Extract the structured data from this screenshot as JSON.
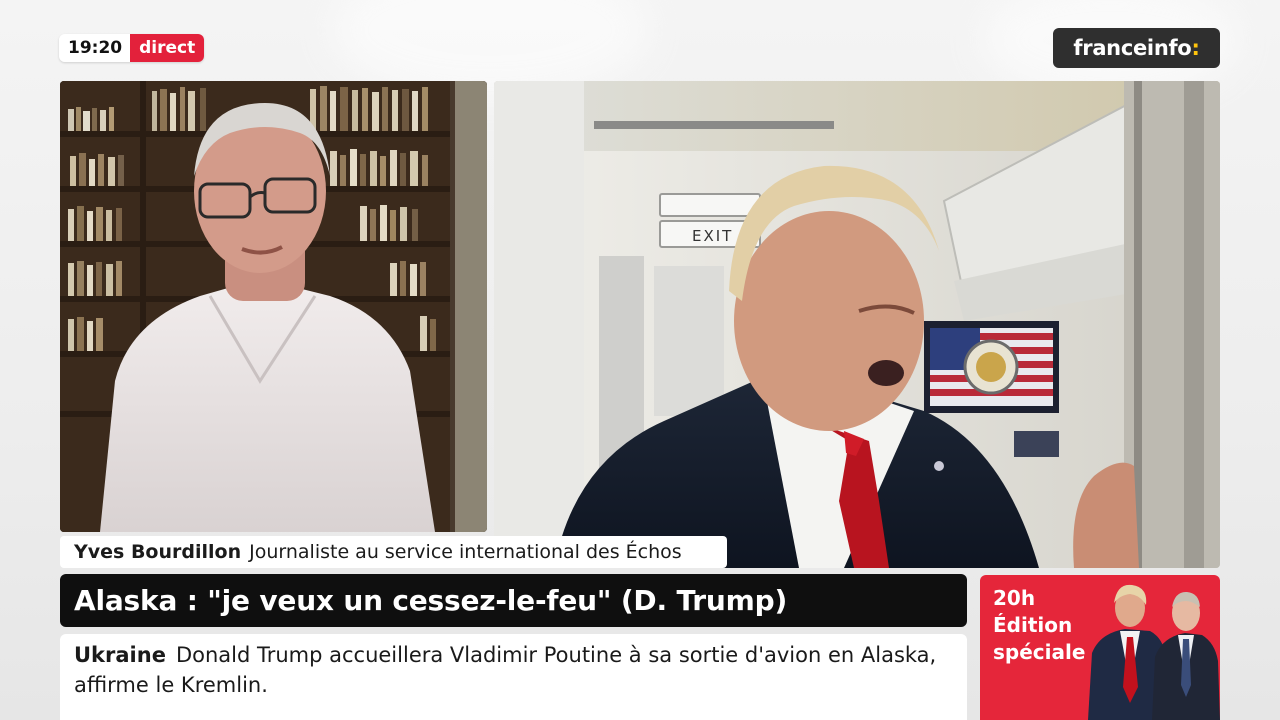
{
  "live_badge": {
    "time": "19:20",
    "label": "direct"
  },
  "brand": {
    "name": "franceinfo",
    "colon": ":"
  },
  "panels": {
    "left": {
      "signage": []
    },
    "right": {
      "exit_sign": "EXIT"
    }
  },
  "nameplate": {
    "name": "Yves Bourdillon",
    "role": "Journaliste au service international des Échos"
  },
  "headline": "Alaska : \"je veux un cessez-le-feu\" (D. Trump)",
  "ticker": {
    "tag": "Ukraine",
    "text": "Donald Trump accueillera Vladimir Poutine à sa sortie d'avion en Alaska, affirme le Kremlin."
  },
  "promo": {
    "line1": "20h",
    "line2": "Édition",
    "line3": "spéciale"
  },
  "colors": {
    "brand_red": "#e3213b",
    "logo_bg": "#2f2f2f",
    "logo_colon": "#ffc40c",
    "headline_bg": "#0f0f0f",
    "promo_bg": "#e5263a"
  }
}
